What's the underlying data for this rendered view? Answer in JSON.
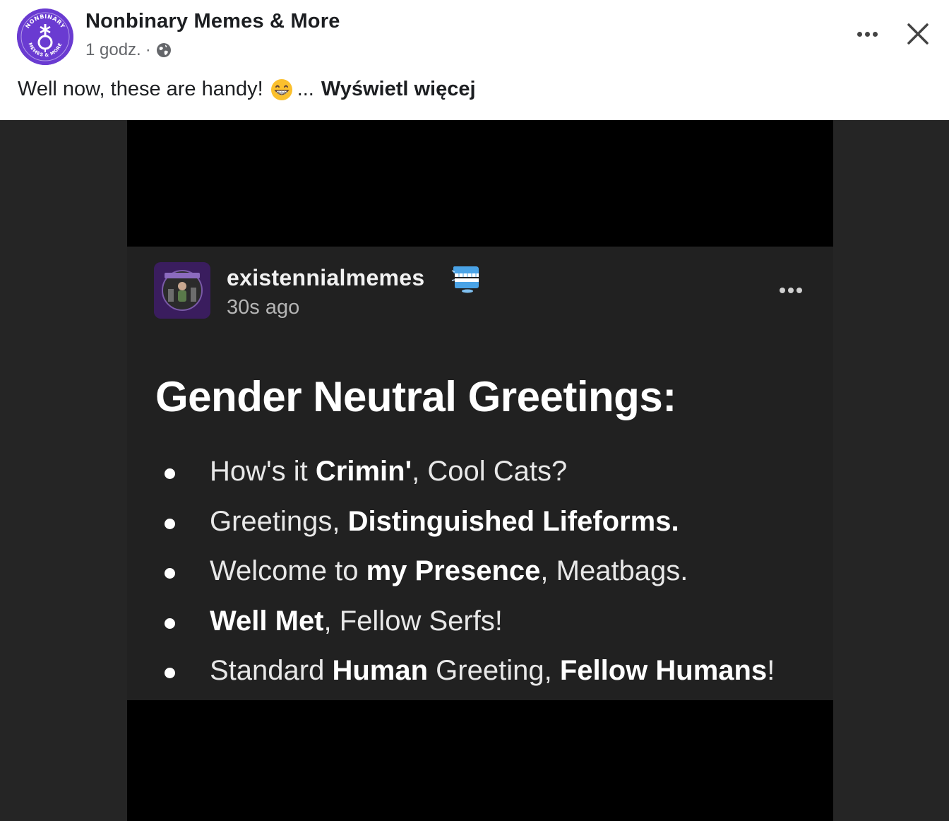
{
  "post": {
    "page_name": "Nonbinary Memes & More",
    "avatar_text_top": "NONBINARY",
    "avatar_text_bottom": "MEMES & MORE",
    "time": "1 godz.",
    "separator": "·",
    "caption": "Well now, these are handy!",
    "emoji": "grinning-face-icon",
    "ellipsis": "...",
    "see_more": "Wyświetl więcej"
  },
  "tumblr": {
    "blog_name": "existennialmemes",
    "time": "30s ago",
    "title": "Gender Neutral Greetings:",
    "items": [
      [
        {
          "t": "How's it ",
          "b": false
        },
        {
          "t": "Crimin'",
          "b": true
        },
        {
          "t": ", Cool Cats?",
          "b": false
        }
      ],
      [
        {
          "t": "Greetings, ",
          "b": false
        },
        {
          "t": "Distinguished Lifeforms.",
          "b": true
        }
      ],
      [
        {
          "t": "Welcome to ",
          "b": false
        },
        {
          "t": "my Presence",
          "b": true
        },
        {
          "t": ", Meatbags.",
          "b": false
        }
      ],
      [
        {
          "t": "Well Met",
          "b": true
        },
        {
          "t": ", Fellow Serfs!",
          "b": false
        }
      ],
      [
        {
          "t": "Standard ",
          "b": false
        },
        {
          "t": "Human",
          "b": true
        },
        {
          "t": " Greeting, ",
          "b": false
        },
        {
          "t": "Fellow Humans",
          "b": true
        },
        {
          "t": "!",
          "b": false
        }
      ]
    ]
  },
  "colors": {
    "brand_purple": "#6a3bd1",
    "media_bg": "#252525",
    "card_bg": "#212121"
  }
}
